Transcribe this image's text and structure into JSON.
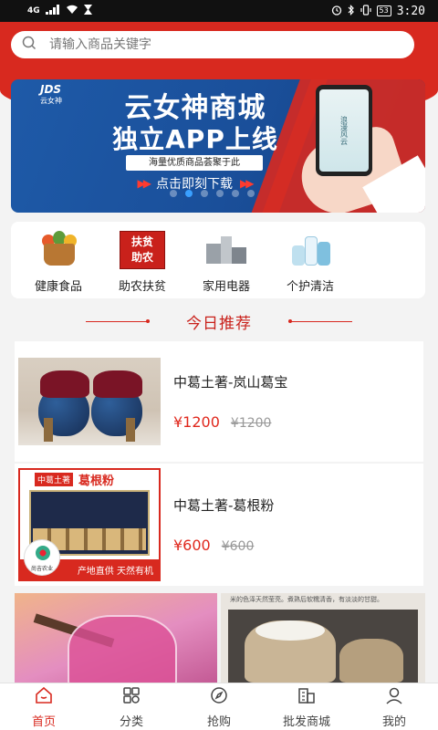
{
  "status_bar": {
    "network": "4G",
    "battery": "53",
    "time": "3:20"
  },
  "search": {
    "placeholder": "请输入商品关键字"
  },
  "banner": {
    "logo_text": "JDS",
    "logo_sub": "云女神",
    "title_line1": "云女神商城",
    "title_line2": "独立APP上线",
    "tagline": "海量优质商品荟聚于此",
    "cta": "点击即刻下载",
    "phone_screen_text": "浪漫风云",
    "slide_count": 6,
    "active_slide": 1
  },
  "categories": [
    {
      "label": "健康食品",
      "icon": "food-basket-icon"
    },
    {
      "label": "助农扶贫",
      "icon": "poverty-relief-icon",
      "icon_text": [
        "扶贫",
        "助农"
      ]
    },
    {
      "label": "家用电器",
      "icon": "appliance-icon"
    },
    {
      "label": "个护清洁",
      "icon": "personal-care-icon"
    }
  ],
  "section": {
    "title": "今日推荐"
  },
  "products": [
    {
      "name": "中葛土著-岚山葛宝",
      "price": "¥1200",
      "original_price": "¥1200"
    },
    {
      "name": "中葛土著-葛根粉",
      "price": "¥600",
      "original_price": "¥600",
      "image_text": {
        "tag": "中葛土著",
        "title": "葛根粉",
        "footer": "产地直供 天然有机",
        "logo": "尚吉农业"
      }
    }
  ],
  "tiles": [
    {
      "name": "drink-tile"
    },
    {
      "name": "rice-tile",
      "caption": "米的色泽天然莹亮。煮熟后软糯清香，有淡淡的甘甜。"
    }
  ],
  "tabbar": [
    {
      "label": "首页",
      "icon": "home-icon",
      "active": true
    },
    {
      "label": "分类",
      "icon": "category-grid-icon",
      "active": false
    },
    {
      "label": "抢购",
      "icon": "compass-icon",
      "active": false
    },
    {
      "label": "批发商城",
      "icon": "wholesale-building-icon",
      "active": false
    },
    {
      "label": "我的",
      "icon": "user-icon",
      "active": false
    }
  ],
  "colors": {
    "brand_red": "#d8291f",
    "price_red": "#e0281d",
    "active_blue": "#3aa0ff"
  }
}
